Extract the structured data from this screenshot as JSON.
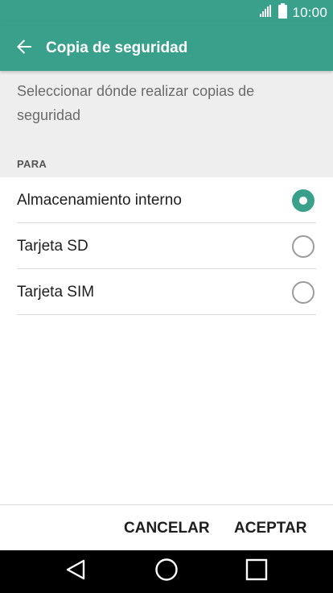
{
  "status_bar": {
    "time": "10:00",
    "signal_icon": "signal-icon",
    "battery_icon": "battery-icon"
  },
  "toolbar": {
    "back_icon": "arrow-left-icon",
    "title": "Copia de seguridad"
  },
  "description": "Seleccionar dónde realizar copias de seguridad",
  "section_header": "PARA",
  "options": [
    {
      "label": "Almacenamiento interno",
      "selected": true
    },
    {
      "label": "Tarjeta SD",
      "selected": false
    },
    {
      "label": "Tarjeta SIM",
      "selected": false
    }
  ],
  "buttons": {
    "cancel": "CANCELAR",
    "accept": "ACEPTAR"
  },
  "nav_bar": {
    "back_icon": "triangle-back-icon",
    "home_icon": "circle-home-icon",
    "recents_icon": "square-recents-icon"
  },
  "colors": {
    "accent": "#39a08c",
    "description_background": "#eeeeee",
    "nav_background": "#000000"
  }
}
